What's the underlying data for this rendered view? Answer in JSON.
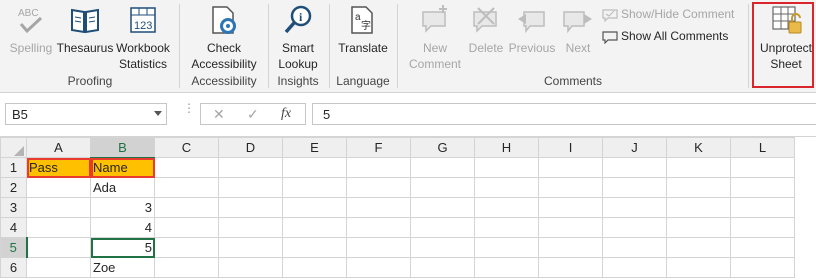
{
  "ribbon": {
    "proofing": {
      "group_label": "Proofing",
      "spelling": {
        "label": "Spelling",
        "icon": "spelling-abc-check-icon"
      },
      "thesaurus": {
        "label": "Thesaurus",
        "icon": "thesaurus-book-icon"
      },
      "workbook_statistics": {
        "label1": "Workbook",
        "label2": "Statistics",
        "icon": "workbook-statistics-icon"
      }
    },
    "accessibility": {
      "group_label": "Accessibility",
      "check": {
        "label1": "Check",
        "label2": "Accessibility",
        "icon": "accessibility-check-icon"
      }
    },
    "insights": {
      "group_label": "Insights",
      "smart_lookup": {
        "label1": "Smart",
        "label2": "Lookup",
        "icon": "smart-lookup-icon"
      }
    },
    "language": {
      "group_label": "Language",
      "translate": {
        "label": "Translate",
        "icon": "translate-icon"
      }
    },
    "comments": {
      "group_label": "Comments",
      "new_comment": {
        "label1": "New",
        "label2": "Comment",
        "icon": "new-comment-icon"
      },
      "delete": {
        "label": "Delete",
        "icon": "delete-comment-icon"
      },
      "previous": {
        "label": "Previous",
        "icon": "previous-comment-icon"
      },
      "next": {
        "label": "Next",
        "icon": "next-comment-icon"
      },
      "show_hide": {
        "label": "Show/Hide Comment",
        "icon": "show-hide-comment-icon"
      },
      "show_all": {
        "label": "Show All Comments",
        "icon": "show-all-comments-icon"
      }
    },
    "protect": {
      "unprotect_sheet": {
        "label1": "Unprotect",
        "label2": "Sheet",
        "icon": "unprotect-sheet-lock-icon"
      }
    }
  },
  "formula_bar": {
    "name_box": "B5",
    "cancel_icon": "✕",
    "enter_icon": "✓",
    "fx_label": "fx",
    "value": "5"
  },
  "sheet": {
    "columns": [
      "A",
      "B",
      "C",
      "D",
      "E",
      "F",
      "G",
      "H",
      "I",
      "J",
      "K",
      "L"
    ],
    "rows": [
      {
        "num": "1",
        "a": "Pass",
        "b": "Name"
      },
      {
        "num": "2",
        "a": "",
        "b": "Ada"
      },
      {
        "num": "3",
        "a": "",
        "b": "3"
      },
      {
        "num": "4",
        "a": "",
        "b": "4"
      },
      {
        "num": "5",
        "a": "",
        "b": "5"
      },
      {
        "num": "6",
        "a": "",
        "b": "Zoe"
      }
    ],
    "header_fill_color": "#ffc000",
    "selection_color": "#217346",
    "highlight_color": "#e63b2e"
  }
}
